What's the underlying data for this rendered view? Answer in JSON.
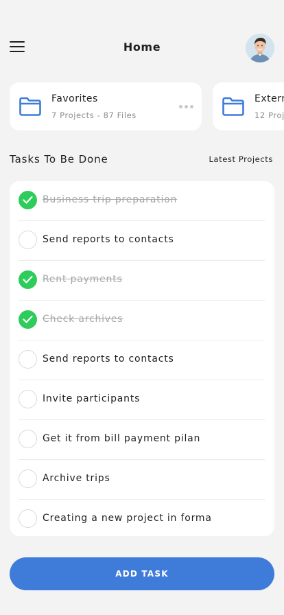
{
  "header": {
    "title": "Home",
    "menu_icon": "hamburger-menu-icon",
    "avatar": "user-avatar"
  },
  "cards": [
    {
      "title": "Favorites",
      "meta": "7 Projects - 87 Files",
      "icon": "folder-icon",
      "more_icon": "more-dots-icon"
    },
    {
      "title": "Extern",
      "meta": "12 Proj",
      "icon": "folder-icon"
    }
  ],
  "section": {
    "title": "Tasks To Be Done",
    "link": "Latest Projects"
  },
  "tasks": [
    {
      "label": "Business trip preparation",
      "done": true
    },
    {
      "label": "Send reports to contacts",
      "done": false
    },
    {
      "label": "Rent payments",
      "done": true
    },
    {
      "label": "Check archives",
      "done": true
    },
    {
      "label": "Send reports to contacts",
      "done": false
    },
    {
      "label": "Invite participants",
      "done": false
    },
    {
      "label": "Get it from bill payment pilan",
      "done": false
    },
    {
      "label": "Archive trips",
      "done": false
    },
    {
      "label": "Creating a new project in forma",
      "done": false
    }
  ],
  "add_button": {
    "label": "ADD TASK"
  },
  "colors": {
    "background": "#f3f3f4",
    "accent": "#3f7bd9",
    "done_green": "#2ecc5a",
    "folder_blue": "#3f7bd9"
  }
}
